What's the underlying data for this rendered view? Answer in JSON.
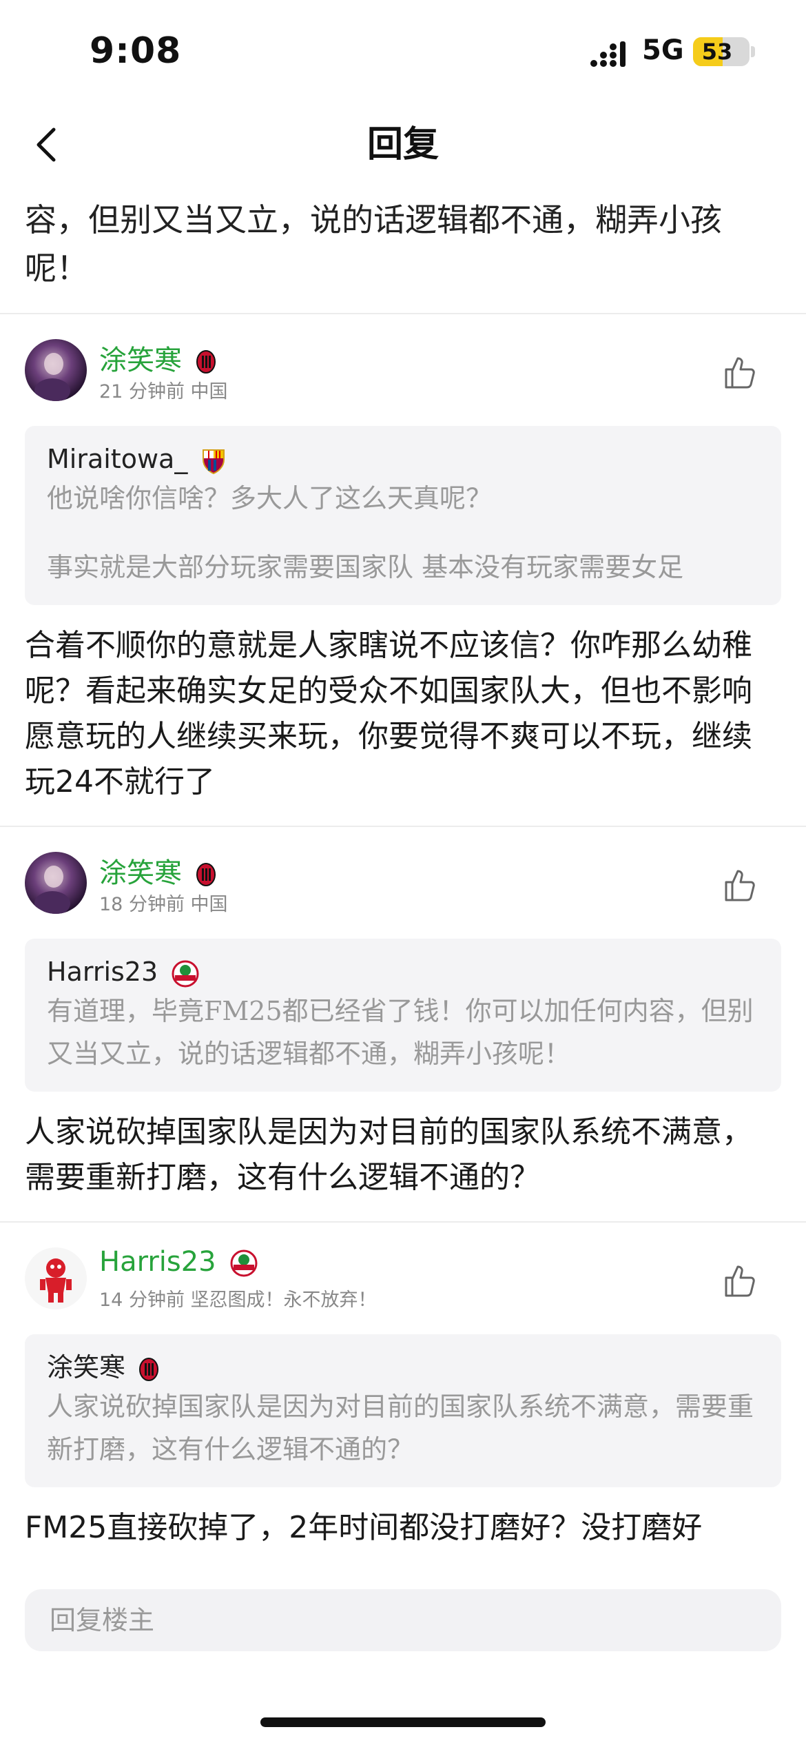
{
  "status_bar": {
    "time": "9:08",
    "network": "5G",
    "battery_level": "53",
    "battery_fraction": 0.53
  },
  "nav": {
    "title": "回复",
    "back_icon": "chevron-left-icon"
  },
  "top_text": "容，但别又当又立，说的话逻辑都不通，糊弄小孩呢！",
  "replies": [
    {
      "user": "涂笑寒",
      "meta": "21 分钟前  中国",
      "quote_user": "Miraitowa_",
      "quote_lines": [
        "他说啥你信啥？多大人了这么天真呢？",
        "事实就是大部分玩家需要国家队 基本没有玩家需要女足"
      ],
      "text": "合着不顺你的意就是人家瞎说不应该信？你咋那么幼稚呢？看起来确实女足的受众不如国家队大，但也不影响愿意玩的人继续买来玩，你要觉得不爽可以不玩，继续玩24不就行了"
    },
    {
      "user": "涂笑寒",
      "meta": "18 分钟前  中国",
      "quote_user": "Harris23",
      "quote_lines": [
        "有道理，毕竟FM25都已经省了钱！你可以加任何内容，但别又当又立，说的话逻辑都不通，糊弄小孩呢！"
      ],
      "text": "人家说砍掉国家队是因为对目前的国家队系统不满意，需要重新打磨，这有什么逻辑不通的？"
    },
    {
      "user": "Harris23",
      "meta": "14 分钟前  坚忍图成！永不放弃！",
      "quote_user": "涂笑寒",
      "quote_lines": [
        "人家说砍掉国家队是因为对目前的国家队系统不满意，需要重新打磨，这有什么逻辑不通的？"
      ],
      "text": "FM25直接砍掉了，2年时间都没打磨好？没打磨好"
    }
  ],
  "reply_box": {
    "placeholder": "回复楼主"
  },
  "colors": {
    "username": "#27a33b",
    "battery": "#f5cc1a"
  }
}
